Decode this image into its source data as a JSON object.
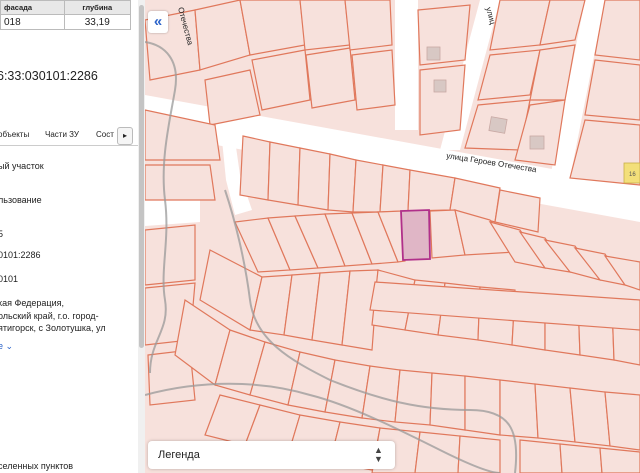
{
  "table": {
    "header": [
      "фасада",
      "глубина"
    ],
    "row": [
      "018",
      "33,19"
    ]
  },
  "cadastral_number_partial": "6:33:030101:2286",
  "tabs": [
    {
      "label": "объекты"
    },
    {
      "label": "Части ЗУ"
    },
    {
      "label": "Сост"
    }
  ],
  "tab_next_label": "▸",
  "fields": [
    "ый участок",
    "льзование",
    "5",
    "0101:2286",
    "0101",
    "кая Федерация,",
    "ольский край, г.о. город-",
    "ятигорск, с Золотушка, ул",
    "",
    "",
    "селенных пунктов"
  ],
  "more_link": "е ⌄",
  "map": {
    "collapse_label": "«",
    "street_labels": [
      "улица Героев Отечества",
      "Отечества",
      "улиц"
    ],
    "building_number": "16",
    "legend_label": "Легенда",
    "colors": {
      "parcel_fill": "#f7e1dc",
      "parcel_stroke": "#e0785c",
      "road": "#ffffff",
      "selected_fill": "#e0b6c6",
      "selected_stroke": "#b0308a",
      "building": "#d8c8c4",
      "yellow_building": "#f3df7a",
      "contour": "#9a9a9a"
    }
  }
}
